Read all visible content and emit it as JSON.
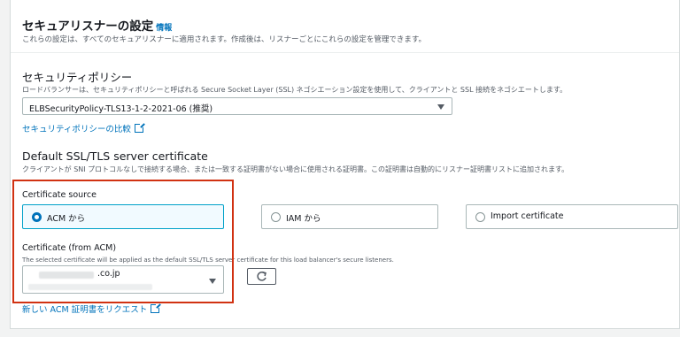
{
  "section": {
    "title": "セキュアリスナーの設定",
    "info_link": "情報",
    "description": "これらの設定は、すべてのセキュアリスナーに適用されます。作成後は、リスナーごとにこれらの設定を管理できます。"
  },
  "security_policy": {
    "title": "セキュリティポリシー",
    "description": "ロードバランサーは、セキュリティポリシーと呼ばれる Secure Socket Layer (SSL) ネゴシエーション設定を使用して、クライアントと SSL 接続をネゴシエートします。",
    "selected": "ELBSecurityPolicy-TLS13-1-2-2021-06 (推奨)",
    "compare_link": "セキュリティポリシーの比較"
  },
  "default_cert": {
    "title": "Default SSL/TLS server certificate",
    "description": "クライアントが SNI プロトコルなしで接続する場合、または一致する証明書がない場合に使用される証明書。この証明書は自動的にリスナー証明書リストに追加されます。"
  },
  "certificate_source": {
    "label": "Certificate source",
    "options": [
      {
        "label": "ACM から",
        "selected": true
      },
      {
        "label": "IAM から",
        "selected": false
      },
      {
        "label": "Import certificate",
        "selected": false
      }
    ]
  },
  "certificate_acm": {
    "label": "Certificate (from ACM)",
    "description": "The selected certificate will be applied as the default SSL/TLS server certificate for this load balancer's secure listeners.",
    "selected_suffix": ".co.jp"
  },
  "request_link": "新しい ACM 証明書をリクエスト",
  "colors": {
    "link": "#0073bb",
    "highlight_border": "#d13212",
    "selected_bg": "#f1faff"
  }
}
